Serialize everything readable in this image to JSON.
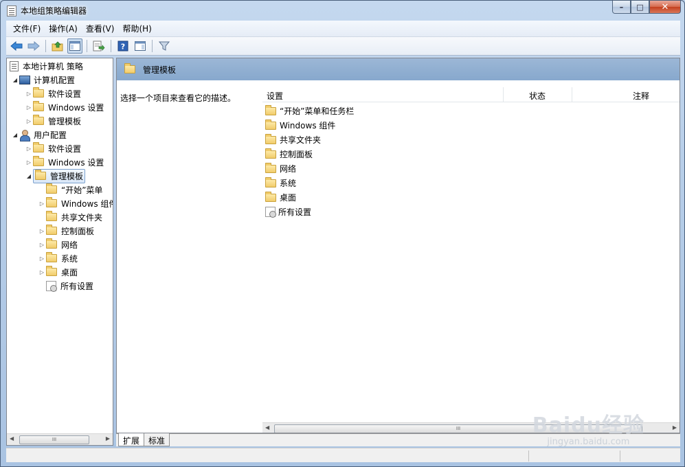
{
  "window": {
    "title": "本地组策略编辑器",
    "minimize_glyph": "–",
    "maximize_glyph": "□",
    "close_glyph": "✕"
  },
  "menu": [
    "文件(F)",
    "操作(A)",
    "查看(V)",
    "帮助(H)"
  ],
  "toolbar": {
    "icons": [
      "back-icon",
      "forward-icon",
      "up-folder-icon",
      "show-hide-tree-icon",
      "export-list-icon",
      "help-icon",
      "show-hide-action-pane-icon",
      "filter-icon"
    ]
  },
  "tree": {
    "root": "本地计算机 策略",
    "computer_config": "计算机配置",
    "user_config": "用户配置",
    "computer_children": [
      "软件设置",
      "Windows 设置",
      "管理模板"
    ],
    "user_children": [
      "软件设置",
      "Windows 设置",
      "管理模板"
    ],
    "admin_template_children": [
      "“开始”菜单",
      "Windows 组件",
      "共享文件夹",
      "控制面板",
      "网络",
      "系统",
      "桌面",
      "所有设置"
    ],
    "expand_glyph": "▷",
    "collapse_glyph": "◢"
  },
  "right": {
    "header_title": "管理模板",
    "description": "选择一个项目来查看它的描述。",
    "columns": [
      "设置",
      "状态",
      "注释"
    ],
    "items": [
      "“开始”菜单和任务栏",
      "Windows 组件",
      "共享文件夹",
      "控制面板",
      "网络",
      "系统",
      "桌面",
      "所有设置"
    ]
  },
  "tabs": [
    "扩展",
    "标准"
  ],
  "scrollbar": {
    "thumb_grip": "III",
    "left_arrow": "◀",
    "right_arrow": "▶"
  },
  "watermark": {
    "logo": "Baidu经验",
    "url": "jingyan.baidu.com"
  }
}
